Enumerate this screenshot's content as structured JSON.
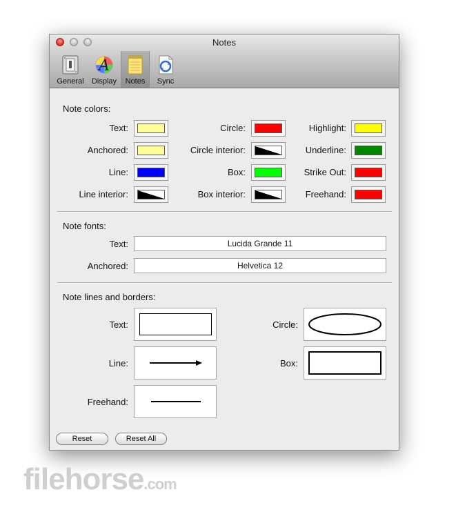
{
  "window": {
    "title": "Notes"
  },
  "toolbar": [
    {
      "label": "General",
      "icon": "switch-icon"
    },
    {
      "label": "Display",
      "icon": "font-color-icon"
    },
    {
      "label": "Notes",
      "icon": "notepad-icon",
      "selected": true
    },
    {
      "label": "Sync",
      "icon": "sync-icon"
    }
  ],
  "colors": {
    "heading": "Note colors:",
    "items": [
      {
        "label": "Text:",
        "color": "#ffff99"
      },
      {
        "label": "Circle:",
        "color": "#ff0000"
      },
      {
        "label": "Highlight:",
        "color": "#ffff00"
      },
      {
        "label": "Anchored:",
        "color": "#ffff99"
      },
      {
        "label": "Circle interior:",
        "color": "transparent"
      },
      {
        "label": "Underline:",
        "color": "#008800"
      },
      {
        "label": "Line:",
        "color": "#0000ff"
      },
      {
        "label": "Box:",
        "color": "#00ff00"
      },
      {
        "label": "Strike Out:",
        "color": "#ff0000"
      },
      {
        "label": "Line interior:",
        "color": "transparent"
      },
      {
        "label": "Box interior:",
        "color": "transparent"
      },
      {
        "label": "Freehand:",
        "color": "#ff0000"
      }
    ]
  },
  "fonts": {
    "heading": "Note fonts:",
    "text_label": "Text:",
    "text_value": "Lucida Grande 11",
    "anchored_label": "Anchored:",
    "anchored_value": "Helvetica 12"
  },
  "lines": {
    "heading": "Note lines and borders:",
    "text_label": "Text:",
    "circle_label": "Circle:",
    "line_label": "Line:",
    "box_label": "Box:",
    "freehand_label": "Freehand:"
  },
  "buttons": {
    "reset": "Reset",
    "reset_all": "Reset All"
  },
  "watermark": {
    "brand": "filehorse",
    "suffix": ".com"
  }
}
